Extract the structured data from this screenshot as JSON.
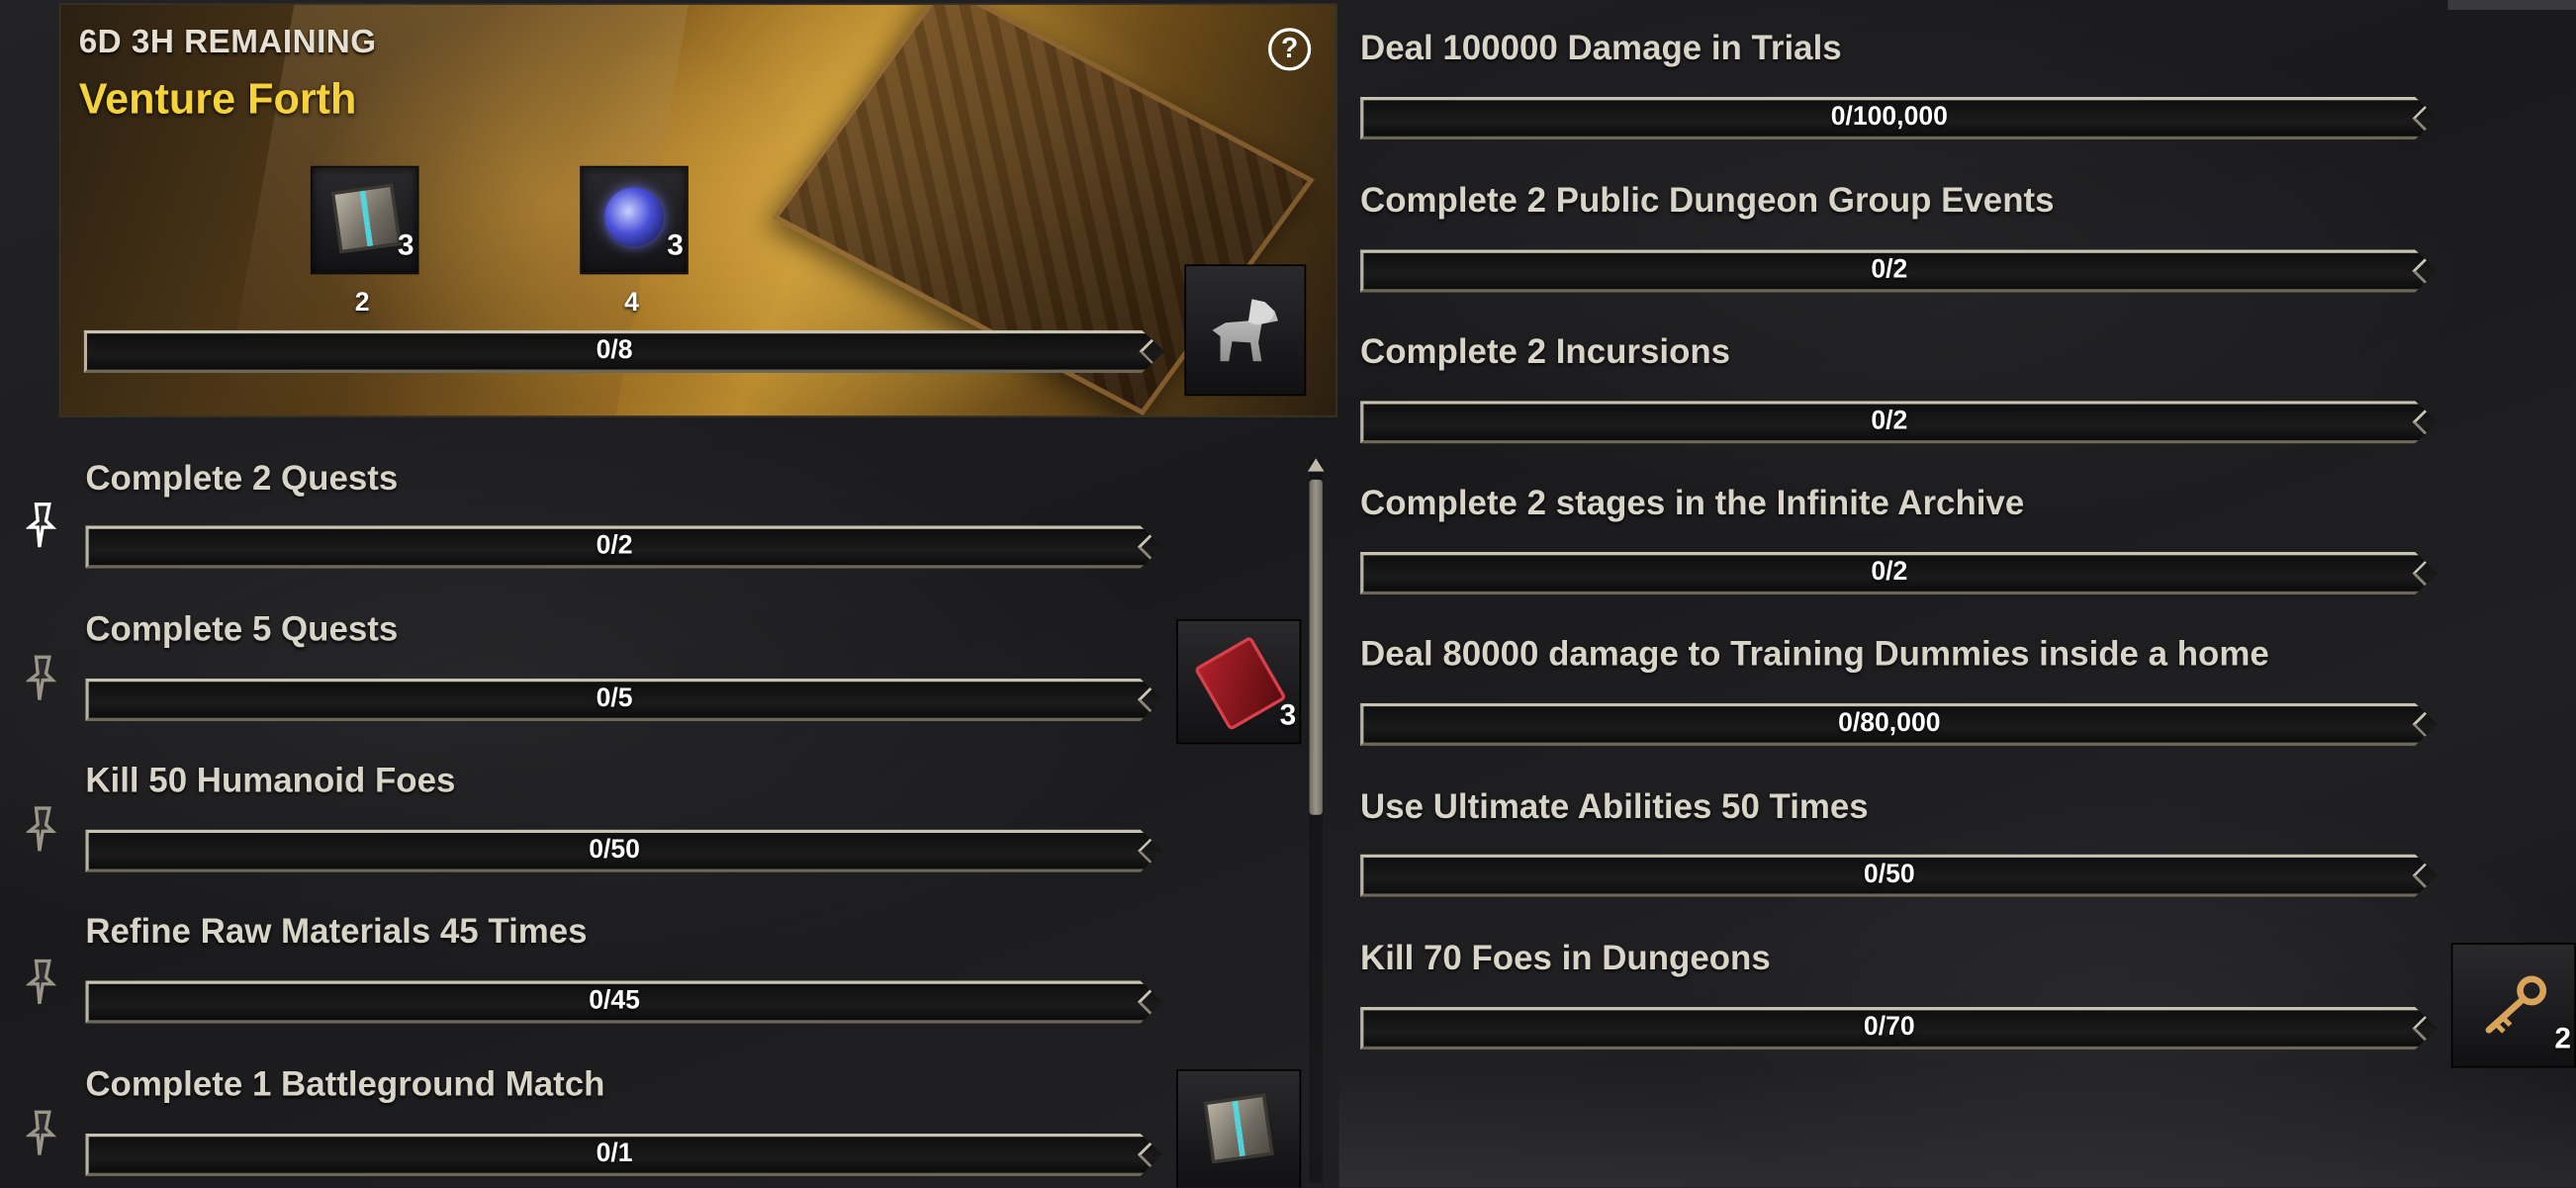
{
  "banner": {
    "remaining": "6D 3H REMAINING",
    "title": "Venture Forth",
    "rewards": [
      {
        "icon": "crate-icon",
        "count": "3",
        "label": "2"
      },
      {
        "icon": "gem-icon",
        "count": "3",
        "label": "4"
      }
    ],
    "progress": {
      "text": "0/8",
      "fraction": 0
    },
    "final_reward_icon": "wolf-icon",
    "help_icon": "help-icon"
  },
  "left_objectives": [
    {
      "label": "Complete 2 Quests",
      "progress": "0/2",
      "fraction": 0
    },
    {
      "label": "Complete 5 Quests",
      "progress": "0/5",
      "fraction": 0
    },
    {
      "label": "Kill 50 Humanoid Foes",
      "progress": "0/50",
      "fraction": 0
    },
    {
      "label": "Refine Raw Materials 45 Times",
      "progress": "0/45",
      "fraction": 0
    },
    {
      "label": "Complete 1 Battleground Match",
      "progress": "0/1",
      "fraction": 0
    }
  ],
  "right_objectives": [
    {
      "label": "Deal 100000 Damage in Trials",
      "progress": "0/100,000",
      "fraction": 0
    },
    {
      "label": "Complete 2 Public Dungeon Group Events",
      "progress": "0/2",
      "fraction": 0
    },
    {
      "label": "Complete 2 Incursions",
      "progress": "0/2",
      "fraction": 0
    },
    {
      "label": "Complete 2 stages in the Infinite Archive",
      "progress": "0/2",
      "fraction": 0
    },
    {
      "label": "Deal 80000 damage to Training Dummies inside a home",
      "progress": "0/80,000",
      "fraction": 0
    },
    {
      "label": "Use Ultimate Abilities 50 Times",
      "progress": "0/50",
      "fraction": 0
    },
    {
      "label": "Kill 70 Foes in Dungeons",
      "progress": "0/70",
      "fraction": 0
    }
  ],
  "side_rewards": {
    "book": {
      "icon": "red-book-icon",
      "count": "3"
    },
    "crate": {
      "icon": "crate-icon"
    },
    "key": {
      "icon": "key-icon",
      "count": "2"
    }
  },
  "colors": {
    "title": "#f5d13a",
    "label": "#d8d4c8",
    "bar_border": "#c8c3b0"
  }
}
